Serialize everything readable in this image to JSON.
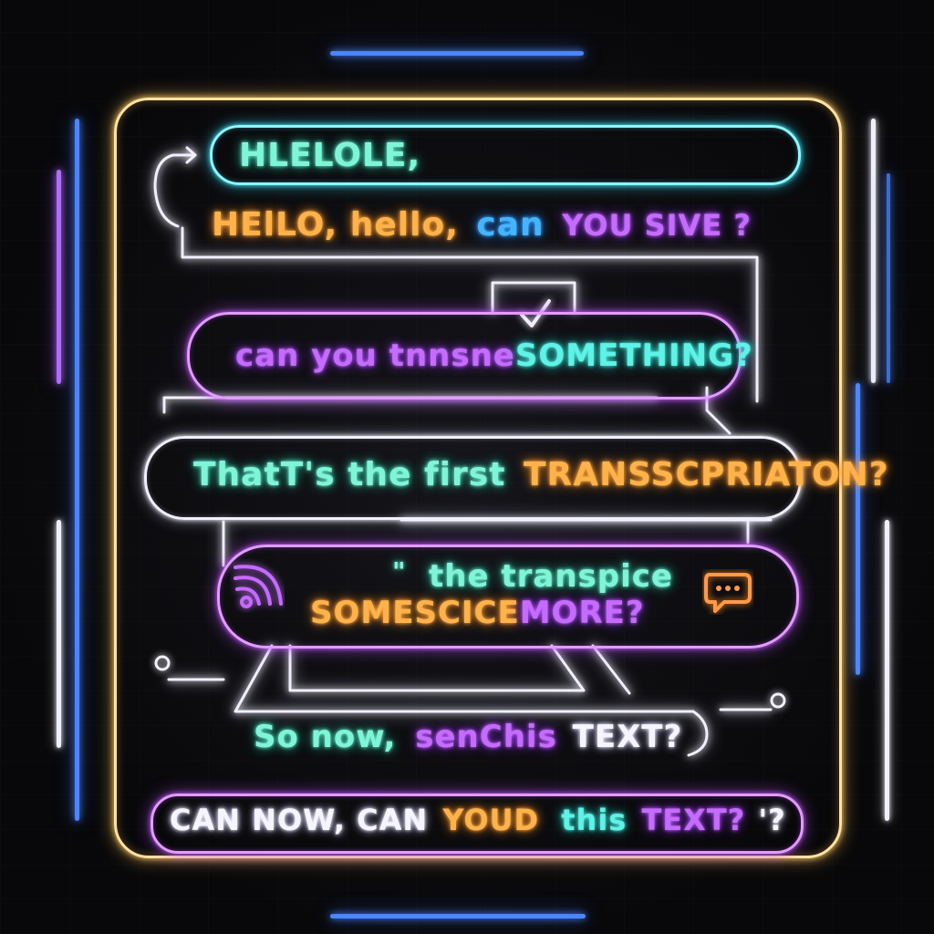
{
  "messages": {
    "m1": "HLELOLE,",
    "m2": {
      "part1": "HElLO,  hello,",
      "part2": "can",
      "part3": "YOU SIVE ?"
    },
    "m3": {
      "part1": "can you tnnsne",
      "part2": "SOMETHING?"
    },
    "m4": {
      "part1": "ThatT's the first",
      "part2": "TRANSSCPRIATON?"
    },
    "m5": {
      "quote": "\"",
      "part1": "the  transpice",
      "part2": "SOMESCICE",
      "part3": "MORE?"
    },
    "m6": {
      "part1": "So now,",
      "part2": "senChis",
      "part3": "TEXT?"
    },
    "m7": {
      "part1": "CAN  NOW, CAN",
      "part2": "YOUD",
      "part3": "this",
      "part4": "TEXT?",
      "part5": "'?"
    }
  },
  "icons": {
    "wifi": "wifi-signal-icon",
    "chat": "chat-bubble-icon",
    "check": "checkmark-icon"
  },
  "colors": {
    "frame": "#ffe3a3",
    "cyan": "#5ff2e6",
    "purple": "#c56bff",
    "orange": "#ffb24a",
    "blue": "#45b4ff",
    "side_bar": "#4a86ff"
  }
}
